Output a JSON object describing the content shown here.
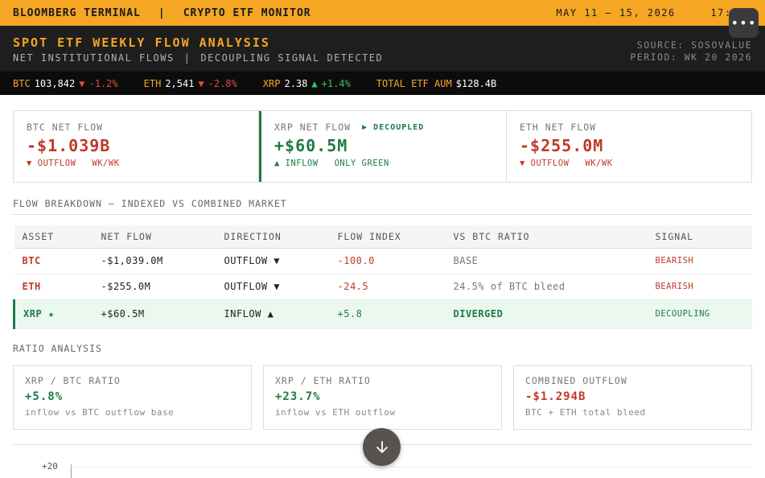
{
  "topbar": {
    "brand": "BLOOMBERG TERMINAL",
    "separator": "|",
    "section": "CRYPTO ETF MONITOR",
    "date_range": "MAY 11 – 15, 2026",
    "time": "17:00"
  },
  "header": {
    "title": "SPOT ETF WEEKLY FLOW ANALYSIS",
    "subtitle_a": "NET INSTITUTIONAL FLOWS",
    "subtitle_sep": "|",
    "subtitle_b": "DECOUPLING SIGNAL DETECTED",
    "source": "SOURCE: SOSOVALUE",
    "period": "PERIOD: WK 20 2026"
  },
  "ticker": [
    {
      "sym": "BTC",
      "price": "103,842",
      "arrow": "▼",
      "change": "-1.2%",
      "dir": "down"
    },
    {
      "sym": "ETH",
      "price": "2,541",
      "arrow": "▼",
      "change": "-2.8%",
      "dir": "down"
    },
    {
      "sym": "XRP",
      "price": "2.38",
      "arrow": "▲",
      "change": "+1.4%",
      "dir": "up"
    },
    {
      "sym": "TOTAL ETF AUM",
      "price": "$128.4B",
      "arrow": "",
      "change": "",
      "dir": "none"
    }
  ],
  "cards": [
    {
      "label": "BTC NET FLOW",
      "tag": "",
      "value": "-$1.039B",
      "foot_a": "▼ OUTFLOW",
      "foot_b": "WK/WK",
      "tone": "red"
    },
    {
      "label": "XRP NET FLOW",
      "tag": "▶ DECOUPLED",
      "value": "+$60.5M",
      "foot_a": "▲ INFLOW",
      "foot_b": "ONLY GREEN",
      "tone": "green"
    },
    {
      "label": "ETH NET FLOW",
      "tag": "",
      "value": "-$255.0M",
      "foot_a": "▼ OUTFLOW",
      "foot_b": "WK/WK",
      "tone": "red"
    }
  ],
  "breakdown": {
    "title": "FLOW BREAKDOWN — INDEXED VS COMBINED MARKET",
    "columns": [
      "ASSET",
      "NET FLOW",
      "DIRECTION",
      "FLOW INDEX",
      "VS BTC RATIO",
      "SIGNAL"
    ],
    "rows": [
      {
        "asset": "BTC",
        "net_flow": "-$1,039.0M",
        "direction": "OUTFLOW ▼",
        "index": "-100.0",
        "ratio": "BASE",
        "signal": "BEARISH"
      },
      {
        "asset": "ETH",
        "net_flow": "-$255.0M",
        "direction": "OUTFLOW ▼",
        "index": "-24.5",
        "ratio": "24.5% of BTC bleed",
        "signal": "BEARISH"
      },
      {
        "asset": "XRP ★",
        "net_flow": "+$60.5M",
        "direction": "INFLOW ▲",
        "index": "+5.8",
        "ratio": "DIVERGED",
        "signal": "DECOUPLING"
      }
    ]
  },
  "ratio": {
    "title": "RATIO ANALYSIS",
    "cards": [
      {
        "label": "XRP / BTC RATIO",
        "value": "+5.8%",
        "note": "inflow vs BTC outflow base",
        "tone": "green"
      },
      {
        "label": "XRP / ETH RATIO",
        "value": "+23.7%",
        "note": "inflow vs ETH outflow",
        "tone": "green"
      },
      {
        "label": "COMBINED OUTFLOW",
        "value": "-$1.294B",
        "note": "BTC + ETH total bleed",
        "tone": "red"
      }
    ]
  },
  "chart": {
    "ytick_top": "+20"
  },
  "colors": {
    "accent": "#f5a623",
    "bear": "#c0392b",
    "bull": "#1e7a44"
  },
  "icons": {
    "more": "more-horizontal-icon",
    "scroll": "arrow-down-icon"
  }
}
